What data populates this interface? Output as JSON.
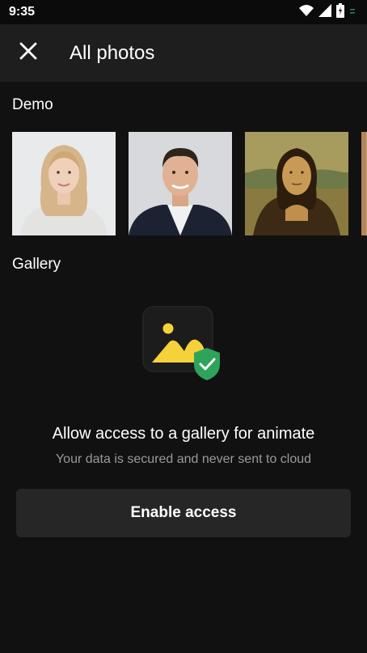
{
  "status_bar": {
    "time": "9:35",
    "icons": [
      "wifi-icon",
      "signal-icon",
      "battery-icon",
      "battery-saver-icon"
    ]
  },
  "app_bar": {
    "close_icon": "close-icon",
    "title": "All photos"
  },
  "demo": {
    "title": "Demo",
    "photos": [
      "woman-portrait",
      "man-portrait",
      "painting-portrait",
      "partial-photo"
    ]
  },
  "gallery": {
    "title": "Gallery",
    "illustration_icon": "gallery-shield-icon",
    "permission_title": "Allow access to a gallery for animate",
    "permission_subtitle": "Your data is secured and never sent to cloud",
    "enable_label": "Enable access"
  },
  "colors": {
    "background": "#111111",
    "app_bar": "#1e1e1e",
    "button": "#262626",
    "accent_yellow": "#f6d23a",
    "shield_green": "#2ea35a"
  }
}
